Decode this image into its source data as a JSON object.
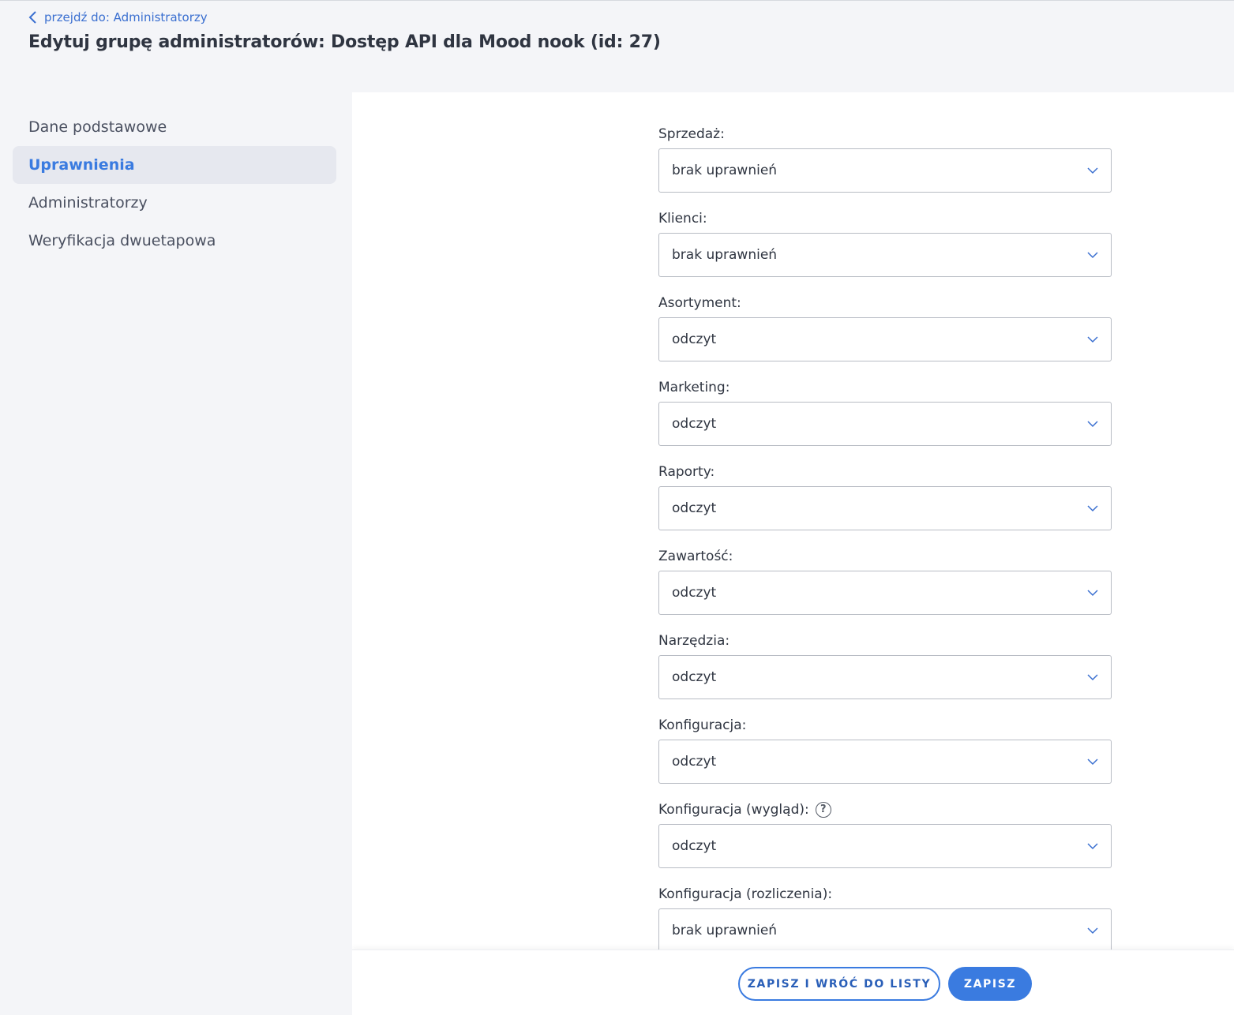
{
  "header": {
    "back_label": "przejdź do: Administratorzy",
    "title": "Edytuj grupę administratorów: Dostęp API dla Mood nook (id: 27)"
  },
  "sidebar": {
    "items": [
      {
        "label": "Dane podstawowe",
        "active": false
      },
      {
        "label": "Uprawnienia",
        "active": true
      },
      {
        "label": "Administratorzy",
        "active": false
      },
      {
        "label": "Weryfikacja dwuetapowa",
        "active": false
      }
    ]
  },
  "form": {
    "fields": [
      {
        "label": "Sprzedaż:",
        "value": "brak uprawnień"
      },
      {
        "label": "Klienci:",
        "value": "brak uprawnień"
      },
      {
        "label": "Asortyment:",
        "value": "odczyt"
      },
      {
        "label": "Marketing:",
        "value": "odczyt"
      },
      {
        "label": "Raporty:",
        "value": "odczyt"
      },
      {
        "label": "Zawartość:",
        "value": "odczyt"
      },
      {
        "label": "Narzędzia:",
        "value": "odczyt"
      },
      {
        "label": "Konfiguracja:",
        "value": "odczyt"
      },
      {
        "label": "Konfiguracja (wygląd):",
        "value": "odczyt",
        "help": "?"
      },
      {
        "label": "Konfiguracja (rozliczenia):",
        "value": "brak uprawnień"
      }
    ]
  },
  "footer": {
    "save_and_back_label": "ZAPISZ I WRÓĆ DO LISTY",
    "save_label": "ZAPISZ"
  },
  "colors": {
    "accent": "#3a7be0",
    "page_background": "#f4f5f8",
    "active_item_background": "#e6e8ef"
  }
}
